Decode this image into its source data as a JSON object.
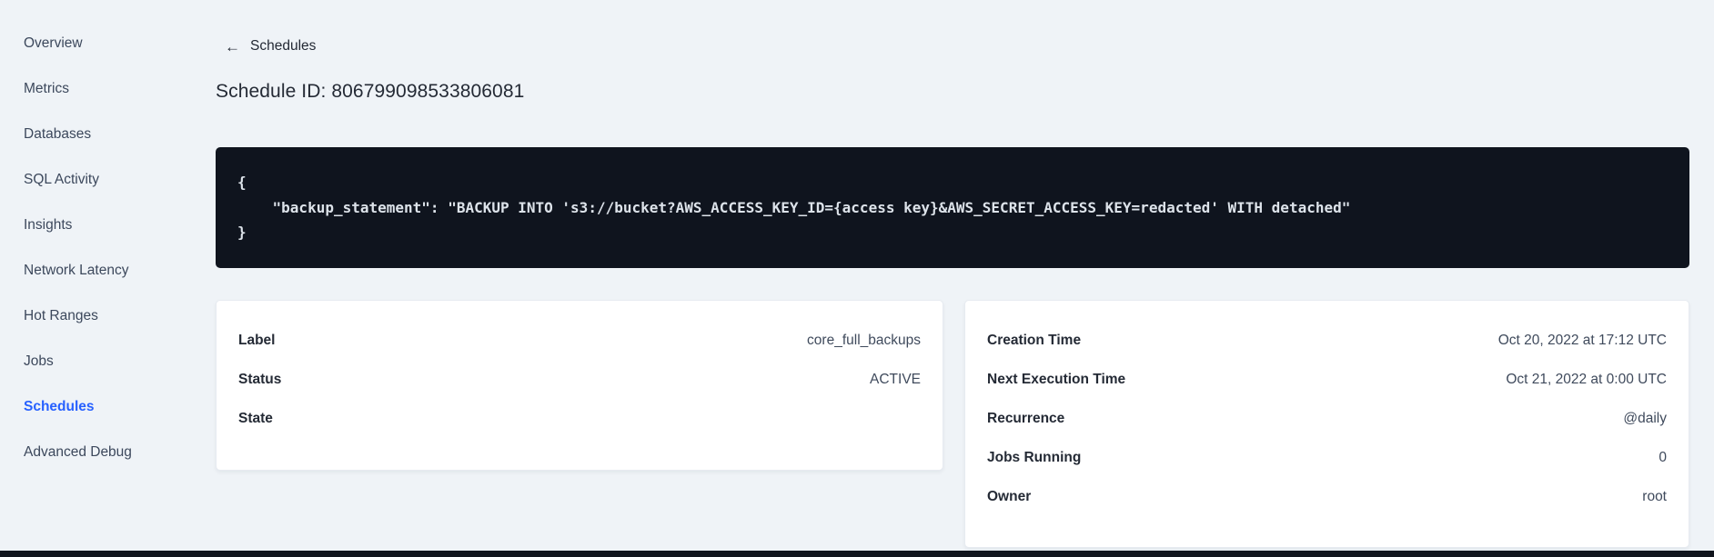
{
  "colors": {
    "accent_blue": "#2761ff",
    "page_background": "#eff3f7",
    "code_background": "#0f141e",
    "code_text": "#dde3ea",
    "heading_text": "#242a35",
    "body_text": "#3f4a5c"
  },
  "sidebar": {
    "items": [
      {
        "label": "Overview",
        "active": false
      },
      {
        "label": "Metrics",
        "active": false
      },
      {
        "label": "Databases",
        "active": false
      },
      {
        "label": "SQL Activity",
        "active": false
      },
      {
        "label": "Insights",
        "active": false
      },
      {
        "label": "Network Latency",
        "active": false
      },
      {
        "label": "Hot Ranges",
        "active": false
      },
      {
        "label": "Jobs",
        "active": false
      },
      {
        "label": "Schedules",
        "active": true
      },
      {
        "label": "Advanced Debug",
        "active": false
      }
    ]
  },
  "header": {
    "back_icon": "←",
    "back_label": "Schedules",
    "title": "Schedule ID: 806799098533806081"
  },
  "code_block": {
    "lines": [
      "{",
      "    \"backup_statement\": \"BACKUP INTO 's3://bucket?AWS_ACCESS_KEY_ID={access key}&AWS_SECRET_ACCESS_KEY=redacted' WITH detached\"",
      "}"
    ]
  },
  "schedule_card": {
    "rows": [
      {
        "label": "Label",
        "value": "core_full_backups"
      },
      {
        "label": "Status",
        "value": "ACTIVE"
      },
      {
        "label": "State",
        "value": ""
      }
    ]
  },
  "execution_card": {
    "rows": [
      {
        "label": "Creation Time",
        "value": "Oct 20, 2022 at 17:12 UTC"
      },
      {
        "label": "Next Execution Time",
        "value": "Oct 21, 2022 at 0:00 UTC"
      },
      {
        "label": "Recurrence",
        "value": "@daily"
      },
      {
        "label": "Jobs Running",
        "value": "0"
      },
      {
        "label": "Owner",
        "value": "root"
      }
    ]
  }
}
